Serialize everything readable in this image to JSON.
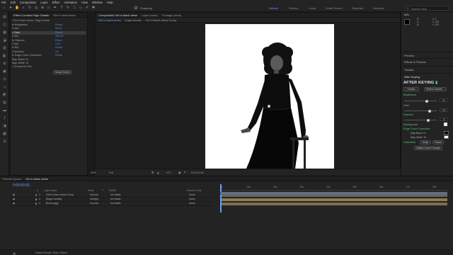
{
  "menu": [
    "File",
    "Edit",
    "Composition",
    "Layer",
    "Effect",
    "Animation",
    "View",
    "Window",
    "Help"
  ],
  "toolbar": {
    "snapping": "Snapping",
    "workspaces": [
      "Default",
      "Review",
      "Learn",
      "Small Screen",
      "Standard",
      "Libraries"
    ],
    "search_placeholder": "Search Help"
  },
  "effect_controls": {
    "tabs": [
      "Effect Controls Edge Details",
      "Girl in black dress"
    ],
    "header": "Girl in black dress • Edge Details",
    "rows": [
      {
        "label": "fx  Brightness",
        "value": "Reset",
        "sel": false
      },
      {
        "label": "     Color",
        "value": "50.00",
        "sel": false
      },
      {
        "label": "v  Gain",
        "value": "Reset",
        "sel": true
      },
      {
        "label": "     Color",
        "value": "100.00",
        "sel": false
      },
      {
        "label": "fx  Gamma",
        "value": "Reset",
        "sel": false
      },
      {
        "label": "     Color",
        "value": "1.00",
        "sel": false
      },
      {
        "label": "fx  BG",
        "value": "Reset",
        "sel": false
      },
      {
        "label": "     Checkbox",
        "value": "On",
        "sel": false
      },
      {
        "label": "fx  Edge Color Correction",
        "value": "Reset",
        "sel": false
      },
      {
        "label": "     Map Black To",
        "value": "",
        "sel": false
      },
      {
        "label": "     Map White To",
        "value": "",
        "sel": false
      },
      {
        "label": "  >  Amount to Tint",
        "value": "",
        "sel": false
      }
    ],
    "button": "Swap Colors"
  },
  "composition": {
    "tabs": [
      "Composition Girl in black dress",
      "Layer (none)",
      "Footage (none)"
    ],
    "subtabs": [
      "Girl in black dress",
      "Edge Details",
      "Girl in black dress Comp"
    ],
    "zoom": "50%",
    "quality": "Full",
    "timecode": "0:00:00:00",
    "extra": "+0.0"
  },
  "right_panel": {
    "info_title": "Info",
    "info_lines": [
      "R:",
      "G:",
      "B:",
      "A: 0",
      "X: 316",
      "Y: 224"
    ],
    "sections": [
      "Preview",
      "Effects & Presets",
      "Tracker",
      "After Keying"
    ],
    "logo": "AFTER KEYING",
    "create_btn": "Create",
    "refine_select": "Refine Details",
    "brightness_label": "Brightness",
    "brightness_value": "50",
    "gain_label": "Gain",
    "gain_value": "100",
    "gamma_label": "Gamma",
    "gamma_value": "70",
    "background_label": "Background",
    "edge_label": "Edge Color Correction",
    "map_black": "Map Black To",
    "map_white": "Map White To",
    "grainblur_label": "Grain/Blur",
    "grain_btn": "Grain",
    "fix_btn": "Frame",
    "adjust_btn": "Adjust Luma Change",
    "accent": "#55c777"
  },
  "timeline": {
    "tabs": [
      "Render Queue",
      "Girl in black dress"
    ],
    "timecode": "0:00:00:00",
    "columns": [
      "#",
      "Layer Name",
      "Mode",
      "T",
      "TrkMat",
      "Parent & Link"
    ],
    "layers": [
      {
        "num": "1",
        "name": "Girl in black dress Comp",
        "mode": "Normal",
        "trk": "No Matte",
        "parent": "None"
      },
      {
        "num": "2",
        "name": "[Edge Details]",
        "mode": "Multiply",
        "trk": "No Matte",
        "parent": "None"
      },
      {
        "num": "3",
        "name": "[Room.jpg]",
        "mode": "Normal",
        "trk": "No Matte",
        "parent": "None"
      }
    ],
    "ruler": [
      "0s",
      "01s",
      "02s",
      "03s",
      "04s",
      "05s",
      "06s",
      "07s",
      "08s"
    ],
    "footer": "Frame Render Time: 128ms"
  }
}
